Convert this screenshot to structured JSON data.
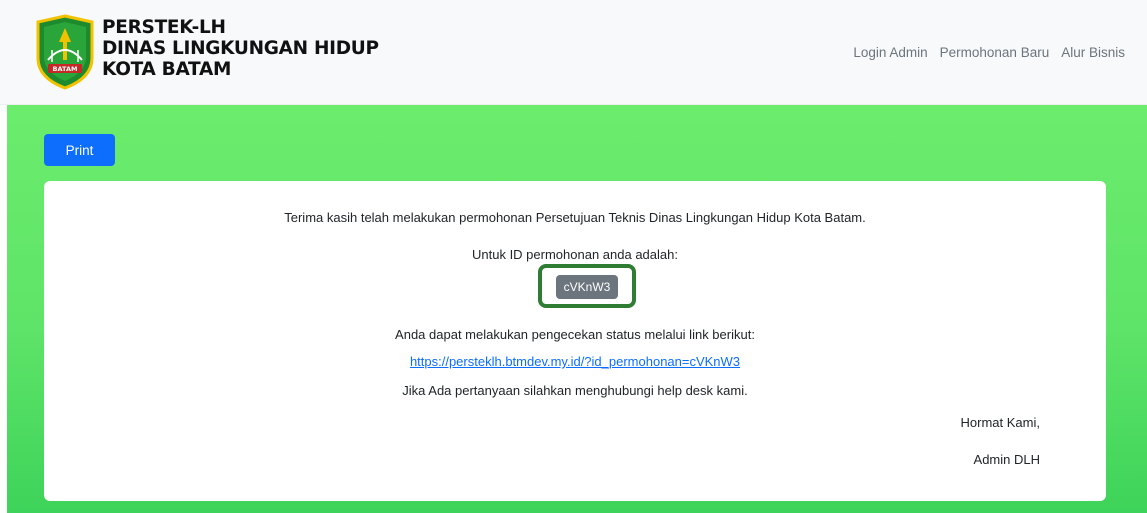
{
  "header": {
    "logo_icon": "batam-city-emblem",
    "logo_text": "BATAM",
    "brand_lines": [
      "PERSTEK-LH",
      "DINAS LINGKUNGAN HIDUP",
      "KOTA BATAM"
    ],
    "nav": [
      "Login Admin",
      "Permohonan Baru",
      "Alur Bisnis"
    ]
  },
  "toolbar": {
    "print_label": "Print"
  },
  "content": {
    "thanks": "Terima kasih telah melakukan permohonan Persetujuan Teknis Dinas Lingkungan Hidup Kota Batam.",
    "id_intro": "Untuk ID permohonan anda adalah:",
    "id_value": "cVKnW3",
    "status_text": "Anda dapat melakukan pengecekan status melalui link berikut:",
    "status_link": "https://persteklh.btmdev.my.id/?id_permohonan=cVKnW3",
    "helpdesk": "Jika Ada pertanyaan silahkan menghubungi help desk kami.",
    "regards": "Hormat Kami,",
    "signature": "Admin DLH"
  },
  "colors": {
    "primary": "#0d6efd",
    "badge": "#6c757d",
    "highlight": "#2e7d32",
    "background_green": "#5ee468"
  }
}
